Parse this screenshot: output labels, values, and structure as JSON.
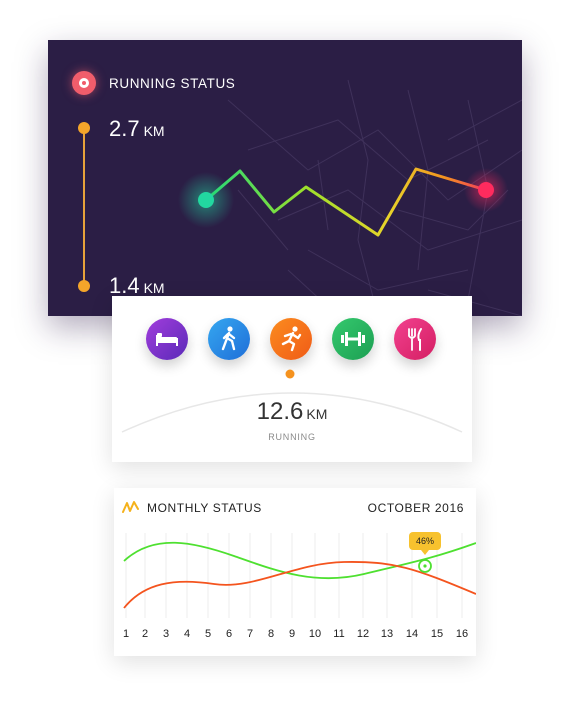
{
  "running": {
    "title": "RUNNING STATUS",
    "distance_top": {
      "value": "2.7",
      "unit": "KM"
    },
    "distance_bottom": {
      "value": "1.4",
      "unit": "KM"
    }
  },
  "activity": {
    "icons": [
      {
        "name": "sleep-icon",
        "color": "#7b2fd0"
      },
      {
        "name": "walk-icon",
        "color": "#2f8de8"
      },
      {
        "name": "run-icon",
        "color": "#f6731e"
      },
      {
        "name": "fitness-icon",
        "color": "#25b864"
      },
      {
        "name": "food-icon",
        "color": "#e8307a"
      }
    ],
    "selected": "run-icon",
    "value": "12.6",
    "unit": "KM",
    "label": "RUNNING"
  },
  "monthly": {
    "title": "MONTHLY STATUS",
    "month": "OCTOBER 2016",
    "badge": "46%",
    "days": [
      "1",
      "2",
      "3",
      "4",
      "5",
      "6",
      "7",
      "8",
      "9",
      "10",
      "11",
      "12",
      "13",
      "14",
      "15",
      "16"
    ],
    "series_colors": {
      "green": "#4ee030",
      "orange": "#f4541e"
    }
  }
}
